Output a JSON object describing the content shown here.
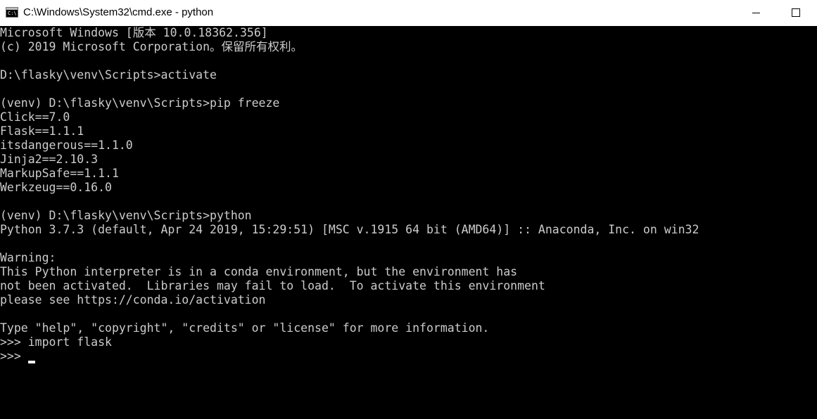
{
  "window": {
    "title": "C:\\Windows\\System32\\cmd.exe - python",
    "icon_text": "C:\\"
  },
  "console": {
    "lines": [
      "Microsoft Windows [版本 10.0.18362.356]",
      "(c) 2019 Microsoft Corporation。保留所有权利。",
      "",
      "D:\\flasky\\venv\\Scripts>activate",
      "",
      "(venv) D:\\flasky\\venv\\Scripts>pip freeze",
      "Click==7.0",
      "Flask==1.1.1",
      "itsdangerous==1.1.0",
      "Jinja2==2.10.3",
      "MarkupSafe==1.1.1",
      "Werkzeug==0.16.0",
      "",
      "(venv) D:\\flasky\\venv\\Scripts>python",
      "Python 3.7.3 (default, Apr 24 2019, 15:29:51) [MSC v.1915 64 bit (AMD64)] :: Anaconda, Inc. on win32",
      "",
      "Warning:",
      "This Python interpreter is in a conda environment, but the environment has",
      "not been activated.  Libraries may fail to load.  To activate this environment",
      "please see https://conda.io/activation",
      "",
      "Type \"help\", \"copyright\", \"credits\" or \"license\" for more information.",
      ">>> import flask",
      ">>> "
    ]
  },
  "colors": {
    "background": "#000000",
    "text": "#cccccc",
    "titlebar": "#ffffff"
  }
}
